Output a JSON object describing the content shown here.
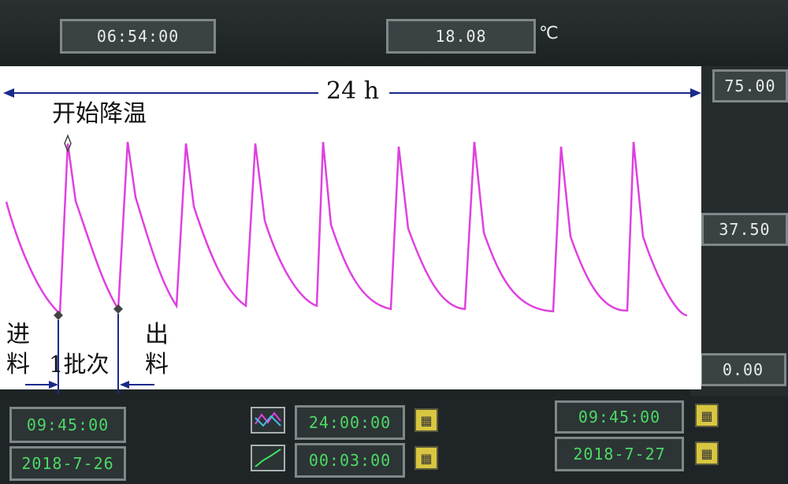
{
  "header": {
    "time": "06:54:00",
    "temperature": "18.08",
    "unit": "℃"
  },
  "y_axis": {
    "top": "75.00",
    "mid": "37.50",
    "bottom": "0.00"
  },
  "annotations": {
    "span": "24 h",
    "start_cooling": "开始降温",
    "feed_in_1": "进",
    "feed_in_2": "料",
    "batch": "1批次",
    "discharge_1": "出",
    "discharge_2": "料"
  },
  "footer": {
    "start_time": "09:45:00",
    "start_date": "2018-7-26",
    "range": "24:00:00",
    "interval": "00:03:00",
    "end_time": "09:45:00",
    "end_date": "2018-7-27"
  },
  "colors": {
    "trace": "#e040e0",
    "arrow": "#1a2a8a",
    "value_green": "#4cd964"
  },
  "icons": {
    "calendar": "calendar-icon",
    "trend_mode": "trend-chart-icon",
    "scale_mode": "scale-chart-icon"
  }
}
